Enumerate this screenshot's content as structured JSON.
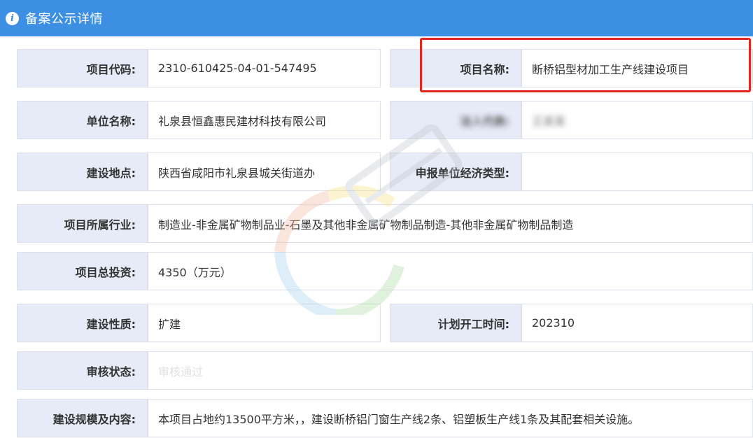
{
  "header": {
    "title": "备案公示详情",
    "icon": "info-icon"
  },
  "rows": {
    "project_code": {
      "label": "项目代码:",
      "value": "2310-610425-04-01-547495"
    },
    "project_name": {
      "label": "项目名称:",
      "value": "断桥铝型材加工生产线建设项目"
    },
    "unit_name": {
      "label": "单位名称:",
      "value": "礼泉县恒鑫惠民建材科技有限公司"
    },
    "redacted": {
      "label": "法人代表:",
      "value": "王某某"
    },
    "location": {
      "label": "建设地点:",
      "value": "陕西省咸阳市礼泉县城关街道办"
    },
    "economic_type": {
      "label": "申报单位经济类型:",
      "value": ""
    },
    "industry": {
      "label": "项目所属行业:",
      "value": "制造业-非金属矿物制品业-石墨及其他非金属矿物制品制造-其他非金属矿物制品制造"
    },
    "investment": {
      "label": "项目总投资:",
      "value": "4350（万元）"
    },
    "nature": {
      "label": "建设性质:",
      "value": "扩建"
    },
    "start_time": {
      "label": "计划开工时间:",
      "value": "202310"
    },
    "review_status": {
      "label": "审核状态:",
      "value": "审核通过"
    },
    "scale": {
      "label": "建设规模及内容:",
      "value": "本项目占地约13500平方米，，建设断桥铝门窗生产线2条、铝塑板生产线1条及其配套相关设施。"
    }
  },
  "colors": {
    "header": "#3d8fe4",
    "label_bg": "#e7eaf7",
    "highlight": "#e5261d"
  }
}
